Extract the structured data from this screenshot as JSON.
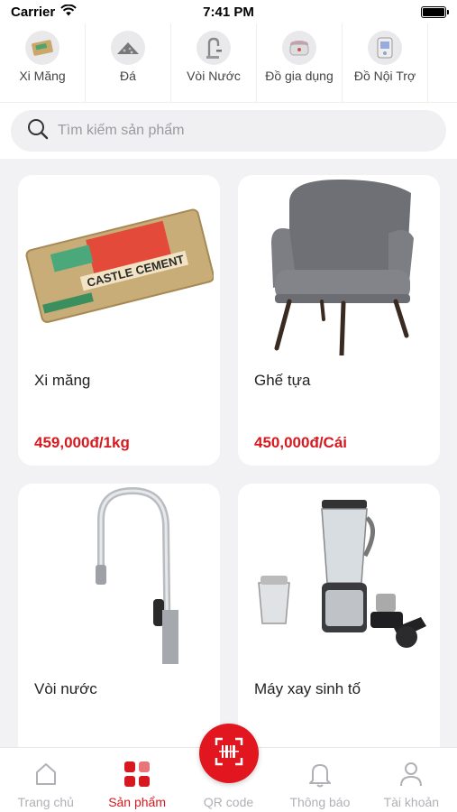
{
  "status_bar": {
    "carrier": "Carrier",
    "time": "7:41 PM"
  },
  "categories": [
    {
      "label": "Xi Măng",
      "icon": "cement-bag-icon"
    },
    {
      "label": "Đá",
      "icon": "gravel-icon"
    },
    {
      "label": "Vòi Nước",
      "icon": "faucet-icon"
    },
    {
      "label": "Đồ gia dụng",
      "icon": "rice-cooker-icon"
    },
    {
      "label": "Đồ Nội Trợ",
      "icon": "appliance-icon"
    }
  ],
  "search": {
    "placeholder": "Tìm kiếm sản phẩm",
    "value": ""
  },
  "products": [
    {
      "name": "Xi măng",
      "price": "459,000đ/1kg",
      "image": "cement-bag-image"
    },
    {
      "name": "Ghế tựa",
      "price": "450,000đ/Cái",
      "image": "armchair-image"
    },
    {
      "name": "Vòi nước",
      "price": "",
      "image": "faucet-image"
    },
    {
      "name": "Máy xay sinh tố",
      "price": "",
      "image": "blender-image"
    }
  ],
  "tabbar": {
    "home": "Trang chủ",
    "products": "Sản phẩm",
    "qr": "QR code",
    "notifications": "Thông báo",
    "account": "Tài khoản"
  },
  "colors": {
    "accent": "#d7191f",
    "fab": "#e2161f",
    "inactive": "#b0b0b6"
  }
}
